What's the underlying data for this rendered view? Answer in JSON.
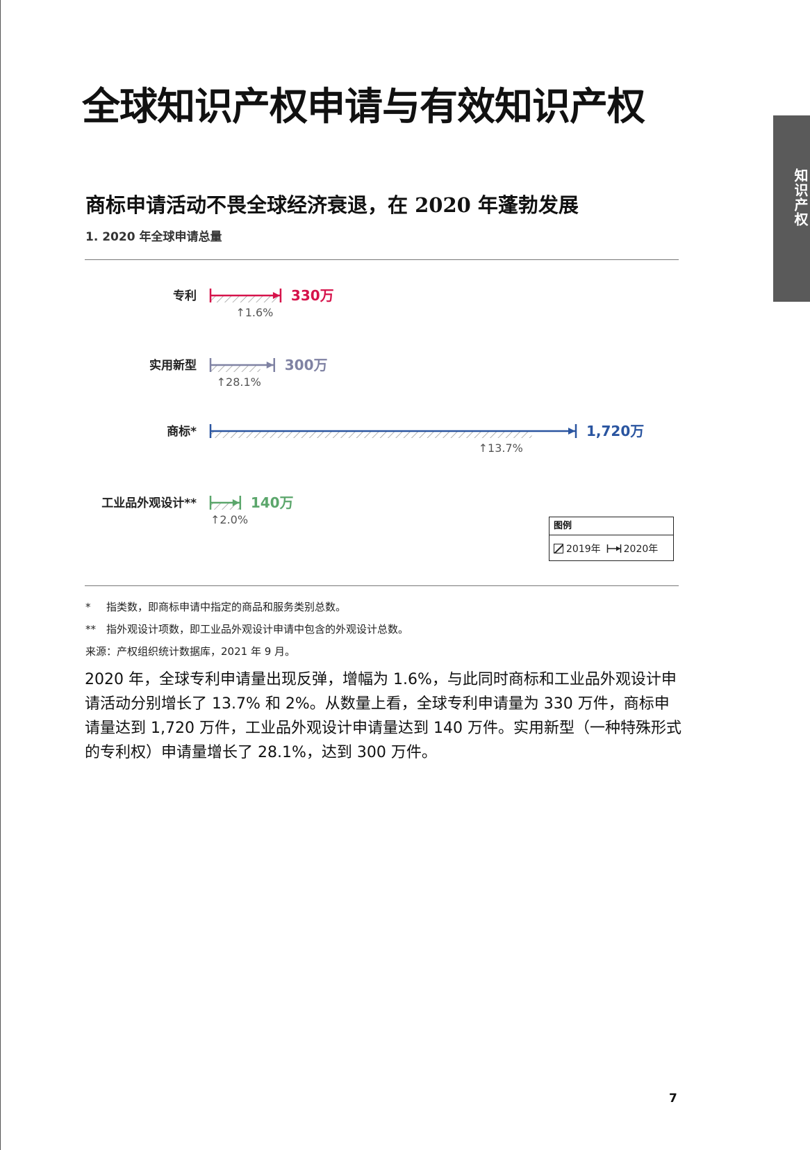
{
  "side_tab": "知识产权",
  "title": "全球知识产权申请与有效知识产权",
  "subtitle": "商标申请活动不畏全球经济衰退，在 2020 年蓬勃发展",
  "chart_label": "1. 2020 年全球申请总量",
  "chart_data": {
    "type": "bar",
    "unit": "万",
    "series": [
      {
        "name": "2019年"
      },
      {
        "name": "2020年"
      }
    ],
    "rows": [
      {
        "label": "专利",
        "value_2020": 330,
        "value_label": "330万",
        "growth_pct": 1.6,
        "growth_label": "↑1.6%",
        "color": "#d6134b"
      },
      {
        "label": "实用新型",
        "value_2020": 300,
        "value_label": "300万",
        "growth_pct": 28.1,
        "growth_label": "↑28.1%",
        "color": "#7f82a3"
      },
      {
        "label": "商标*",
        "value_2020": 1720,
        "value_label": "1,720万",
        "growth_pct": 13.7,
        "growth_label": "↑13.7%",
        "color": "#2a55a0"
      },
      {
        "label": "工业品外观设计**",
        "value_2020": 140,
        "value_label": "140万",
        "growth_pct": 2.0,
        "growth_label": "↑2.0%",
        "color": "#5ba66b"
      }
    ]
  },
  "legend": {
    "title": "图例",
    "item_2019": "2019年",
    "item_2020": "2020年"
  },
  "footnotes": {
    "fn1_mark": "*",
    "fn1_text": "指类数，即商标申请中指定的商品和服务类别总数。",
    "fn2_mark": "**",
    "fn2_text": "指外观设计项数，即工业品外观设计申请中包含的外观设计总数。",
    "source": "来源：产权组织统计数据库，2021 年 9 月。"
  },
  "paragraph": "2020 年，全球专利申请量出现反弹，增幅为 1.6%，与此同时商标和工业品外观设计申请活动分别增长了 13.7% 和 2%。从数量上看，全球专利申请量为 330 万件，商标申请量达到 1,720 万件，工业品外观设计申请量达到 140 万件。实用新型（一种特殊形式的专利权）申请量增长了 28.1%，达到 300 万件。",
  "page_number": "7"
}
